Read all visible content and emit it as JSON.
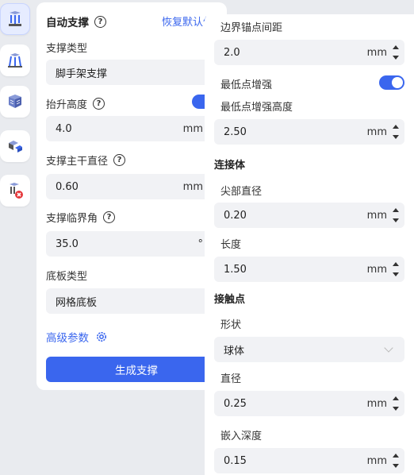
{
  "toolbar": {
    "tools": [
      {
        "name": "auto-support-tool",
        "icon": "support-columns-icon",
        "active": true
      },
      {
        "name": "manual-support-tool",
        "icon": "support-legs-icon",
        "active": false
      },
      {
        "name": "support-grid-tool",
        "icon": "support-grid-icon",
        "active": false
      },
      {
        "name": "support-edit-tool",
        "icon": "support-edit-icon",
        "active": false
      },
      {
        "name": "delete-support-tool",
        "icon": "support-delete-icon",
        "active": false
      }
    ]
  },
  "left_panel": {
    "title": "自动支撑",
    "reset_label": "恢复默认值",
    "support_type": {
      "label": "支撑类型",
      "value": "脚手架支撑"
    },
    "lift_height": {
      "label": "抬升高度",
      "value": "4.0",
      "unit": "mm",
      "enabled": true
    },
    "trunk_diameter": {
      "label": "支撑主干直径",
      "value": "0.60",
      "unit": "mm"
    },
    "critical_angle": {
      "label": "支撑临界角",
      "value": "35.0",
      "unit": "°"
    },
    "base_type": {
      "label": "底板类型",
      "value": "网格底板"
    },
    "advanced_label": "高级参数",
    "generate_label": "生成支撑"
  },
  "right_panel": {
    "border_anchor_spacing": {
      "label": "边界锚点间距",
      "value": "2.0",
      "unit": "mm"
    },
    "lowest_point_reinforce": {
      "label": "最低点增强",
      "enabled": true
    },
    "lowest_point_height": {
      "label": "最低点增强高度",
      "value": "2.50",
      "unit": "mm"
    },
    "connector_section": "连接体",
    "tip_diameter": {
      "label": "尖部直径",
      "value": "0.20",
      "unit": "mm"
    },
    "length": {
      "label": "长度",
      "value": "1.50",
      "unit": "mm"
    },
    "contact_section": "接触点",
    "shape": {
      "label": "形状",
      "value": "球体"
    },
    "diameter": {
      "label": "直径",
      "value": "0.25",
      "unit": "mm"
    },
    "embed_depth": {
      "label": "嵌入深度",
      "value": "0.15",
      "unit": "mm"
    }
  },
  "colors": {
    "accent": "#3a66ee",
    "field_bg": "#f1f2f5",
    "page_bg": "#e9ebef"
  }
}
